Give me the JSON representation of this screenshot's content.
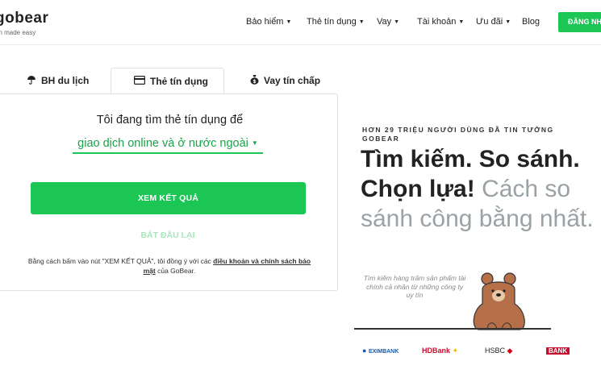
{
  "header": {
    "logo_text": "gobear",
    "tagline": "on made easy",
    "nav": [
      {
        "label": "Bảo hiểm"
      },
      {
        "label": "Thẻ tín dụng"
      },
      {
        "label": "Vay"
      },
      {
        "label": "Tài khoản"
      },
      {
        "label": "Ưu đãi"
      },
      {
        "label": "Blog"
      }
    ],
    "signup_label": "ĐĂNG NHẬP"
  },
  "tabs": [
    {
      "label": "BH du lịch",
      "icon": "umbrella-icon",
      "active": false
    },
    {
      "label": "Thẻ tín dụng",
      "icon": "credit-card-icon",
      "active": true
    },
    {
      "label": "Vay tín chấp",
      "icon": "money-bag-icon",
      "active": false
    }
  ],
  "search": {
    "heading": "Tôi đang tìm thẻ tín dụng để",
    "selected_option": "giao dịch online và ở nước ngoài",
    "submit_label": "XEM KẾT QUẢ",
    "reset_label": "BẮT ĐẦU LẠI",
    "terms_prefix": "Bằng cách bấm vào nút \"XEM KẾT QUẢ\", tôi đồng ý với các",
    "terms_link": "điều khoản và chính sách bảo mật",
    "terms_suffix": "của GoBear."
  },
  "hero": {
    "trust_line": "HƠN 29 TRIỆU NGƯỜI DÙNG ĐÃ TIN TƯỞNG GOBEAR",
    "headline_bold": "Tìm kiếm. So sánh. Chọn lựa!",
    "headline_light": "Cách so sánh công bằng nhất.",
    "bear_caption": "Tìm kiếm hàng trăm sản phẩm tài chính cả nhân từ những công ty uy tín"
  },
  "partners": [
    {
      "name": "EXIMBANK",
      "color": "#1a5aa8"
    },
    {
      "name": "HDBank",
      "color": "#c8102e"
    },
    {
      "name": "HSBC",
      "color": "#222222"
    },
    {
      "name": "BANK",
      "color": "#c8102e"
    }
  ],
  "colors": {
    "accent": "#1cc655",
    "accent_text": "#1aa34a",
    "muted_headline": "#9aa2a6",
    "bear": "#b5704a"
  }
}
